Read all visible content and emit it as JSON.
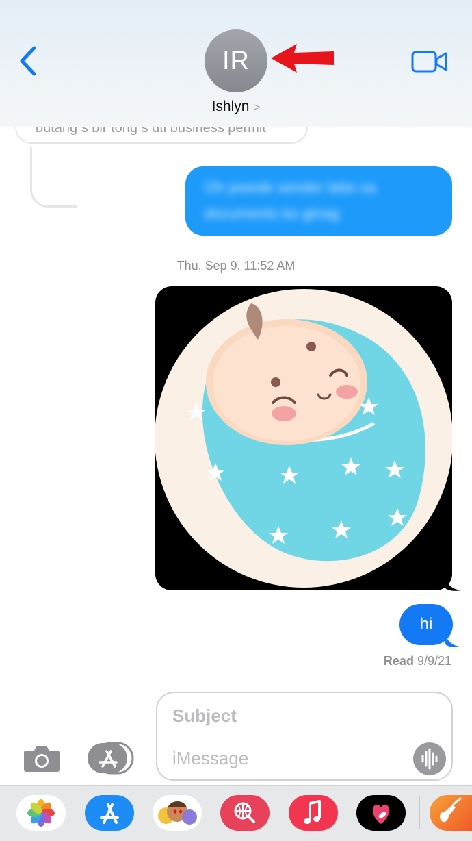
{
  "header": {
    "avatar_initials": "IR",
    "contact_name": "Ishlyn",
    "chevron": ">"
  },
  "messages": {
    "faded_reply_text": "butang s bir tong s dti business permit",
    "blurred_line_1": "Oh pwede sender labo sa",
    "blurred_line_2": "documents ko ginag",
    "timestamp": "Thu, Sep 9, 11:52 AM",
    "hi_text": "hi",
    "read_label": "Read",
    "read_date": "9/9/21"
  },
  "compose": {
    "subject_placeholder": "Subject",
    "message_placeholder": "iMessage"
  },
  "colors": {
    "accent": "#1479f5",
    "sent_bubble": "#1e9bfa",
    "annotation_arrow": "#e8141b"
  },
  "drawer_apps": [
    "photos-app",
    "app-store-app",
    "memoji-app",
    "web-search-app",
    "music-app",
    "digital-touch-app",
    "garageband-app"
  ]
}
